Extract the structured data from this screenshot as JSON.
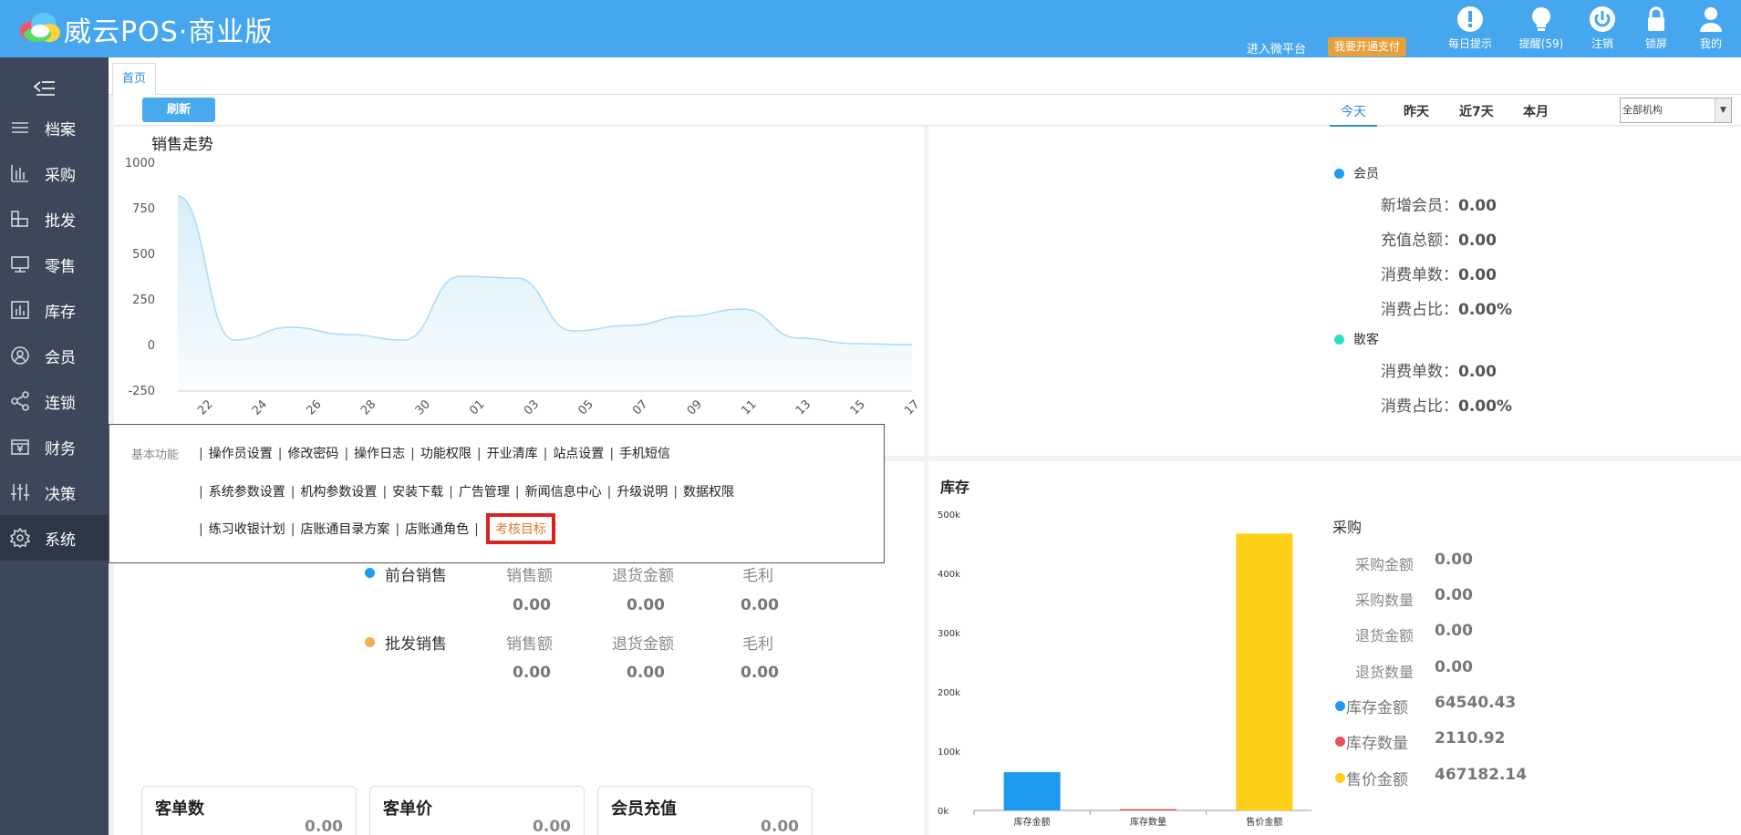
{
  "header": {
    "app_title": "威云POS·商业版",
    "link_wechat": "进入微平台",
    "pay_button": "我要开通支付",
    "icons": [
      {
        "name": "daily-tips-icon",
        "label": "每日提示"
      },
      {
        "name": "reminder-icon",
        "label": "提醒(59)"
      },
      {
        "name": "logout-icon",
        "label": "注销"
      },
      {
        "name": "lock-screen-icon",
        "label": "锁屏"
      },
      {
        "name": "user-icon",
        "label": "我的"
      }
    ]
  },
  "sidebar": {
    "items": [
      {
        "label": "档案",
        "icon": "list-icon"
      },
      {
        "label": "采购",
        "icon": "bar-chart-icon"
      },
      {
        "label": "批发",
        "icon": "boxes-icon"
      },
      {
        "label": "零售",
        "icon": "monitor-icon"
      },
      {
        "label": "库存",
        "icon": "stock-chart-icon"
      },
      {
        "label": "会员",
        "icon": "member-icon"
      },
      {
        "label": "连锁",
        "icon": "share-icon"
      },
      {
        "label": "财务",
        "icon": "finance-icon"
      },
      {
        "label": "决策",
        "icon": "sliders-icon"
      },
      {
        "label": "系统",
        "icon": "gear-icon"
      }
    ],
    "active": "系统"
  },
  "tabs": [
    "首页"
  ],
  "toolbar": {
    "refresh": "刷新",
    "periods": [
      "今天",
      "昨天",
      "近7天",
      "本月"
    ],
    "active_period": "今天",
    "org_select": "全部机构"
  },
  "sales_trend": {
    "title": "销售走势"
  },
  "chart_data": [
    {
      "type": "area",
      "title": "销售走势",
      "x": [
        "22",
        "24",
        "26",
        "28",
        "30",
        "01",
        "03",
        "05",
        "07",
        "09",
        "11",
        "13",
        "15",
        "17"
      ],
      "values": [
        820,
        30,
        100,
        60,
        30,
        380,
        370,
        80,
        110,
        160,
        200,
        40,
        10,
        5
      ],
      "ylim": [
        -250,
        1000
      ],
      "yticks": [
        "1000",
        "750",
        "500",
        "250",
        "0",
        "-250"
      ],
      "colors": {
        "line": "#a8dcf2",
        "fill": "#d6eefa"
      }
    },
    {
      "type": "bar",
      "title": "库存",
      "categories": [
        "库存金额",
        "库存数量",
        "售价金额"
      ],
      "values": [
        64540.43,
        2110.92,
        467182.14
      ],
      "ylim": [
        0,
        500000
      ],
      "yticks": [
        "500k",
        "400k",
        "300k",
        "200k",
        "100k",
        "0k"
      ],
      "colors": [
        "#1e9bf0",
        "#e8525a",
        "#fdd017"
      ]
    }
  ],
  "member": {
    "title": "会员",
    "rows": [
      {
        "label": "新增会员：",
        "value": "0.00"
      },
      {
        "label": "充值总额：",
        "value": "0.00"
      },
      {
        "label": "消费单数：",
        "value": "0.00"
      },
      {
        "label": "消费占比：",
        "value": "0.00%"
      }
    ],
    "walkin_title": "散客",
    "walkin_rows": [
      {
        "label": "消费单数：",
        "value": "0.00"
      },
      {
        "label": "消费占比：",
        "value": "0.00%"
      }
    ]
  },
  "sales": {
    "front": {
      "title": "前台销售",
      "cols": [
        "销售额",
        "退货金额",
        "毛利"
      ],
      "vals": [
        "0.00",
        "0.00",
        "0.00"
      ]
    },
    "wholesale": {
      "title": "批发销售",
      "cols": [
        "销售额",
        "退货金额",
        "毛利"
      ],
      "vals": [
        "0.00",
        "0.00",
        "0.00"
      ]
    }
  },
  "cards": [
    {
      "title": "客单数",
      "value": "0.00"
    },
    {
      "title": "客单价",
      "value": "0.00"
    },
    {
      "title": "会员充值",
      "value": "0.00"
    }
  ],
  "inventory": {
    "title": "库存",
    "purchase_title": "采购",
    "purchase_rows": [
      {
        "label": "采购金额",
        "value": "0.00"
      },
      {
        "label": "采购数量",
        "value": "0.00"
      },
      {
        "label": "退货金额",
        "value": "0.00"
      },
      {
        "label": "退货数量",
        "value": "0.00"
      }
    ],
    "stock_rows": [
      {
        "label": "库存金额",
        "value": "64540.43",
        "color": "#1e9bf0"
      },
      {
        "label": "库存数量",
        "value": "2110.92",
        "color": "#e8525a"
      },
      {
        "label": "售价金额",
        "value": "467182.14",
        "color": "#fdd017"
      }
    ]
  },
  "popup": {
    "group": "基本功能",
    "row1": [
      "操作员设置",
      "修改密码",
      "操作日志",
      "功能权限",
      "开业清库",
      "站点设置",
      "手机短信"
    ],
    "row2": [
      "系统参数设置",
      "机构参数设置",
      "安装下载",
      "广告管理",
      "新闻信息中心",
      "升级说明",
      "数据权限"
    ],
    "row3": [
      "练习收银计划",
      "店账通目录方案",
      "店账通角色"
    ],
    "highlight": "考核目标"
  }
}
